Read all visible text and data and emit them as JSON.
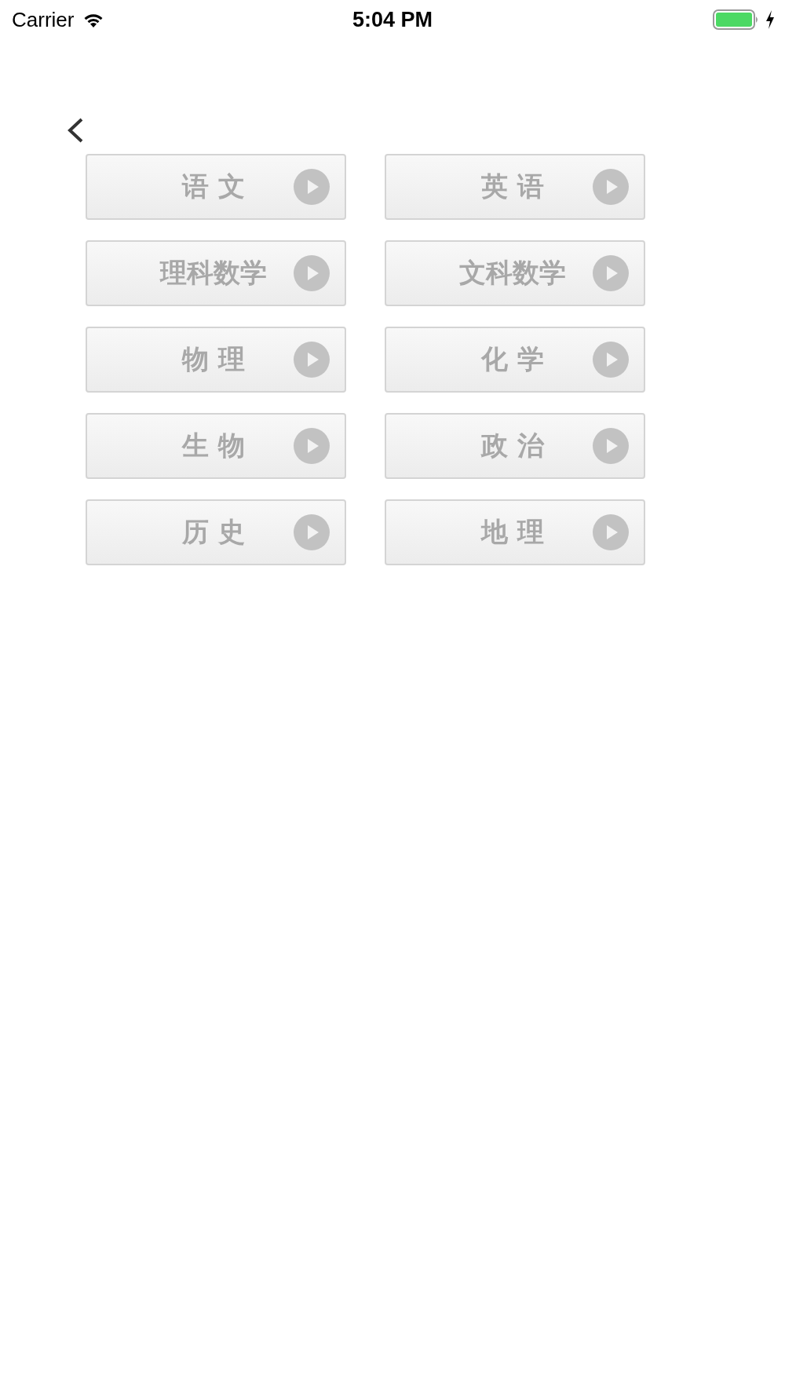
{
  "status_bar": {
    "carrier": "Carrier",
    "time": "5:04 PM"
  },
  "subjects": [
    {
      "label": "语 文"
    },
    {
      "label": "英 语"
    },
    {
      "label": "理科数学"
    },
    {
      "label": "文科数学"
    },
    {
      "label": "物 理"
    },
    {
      "label": "化 学"
    },
    {
      "label": "生 物"
    },
    {
      "label": "政 治"
    },
    {
      "label": "历 史"
    },
    {
      "label": "地 理"
    }
  ]
}
